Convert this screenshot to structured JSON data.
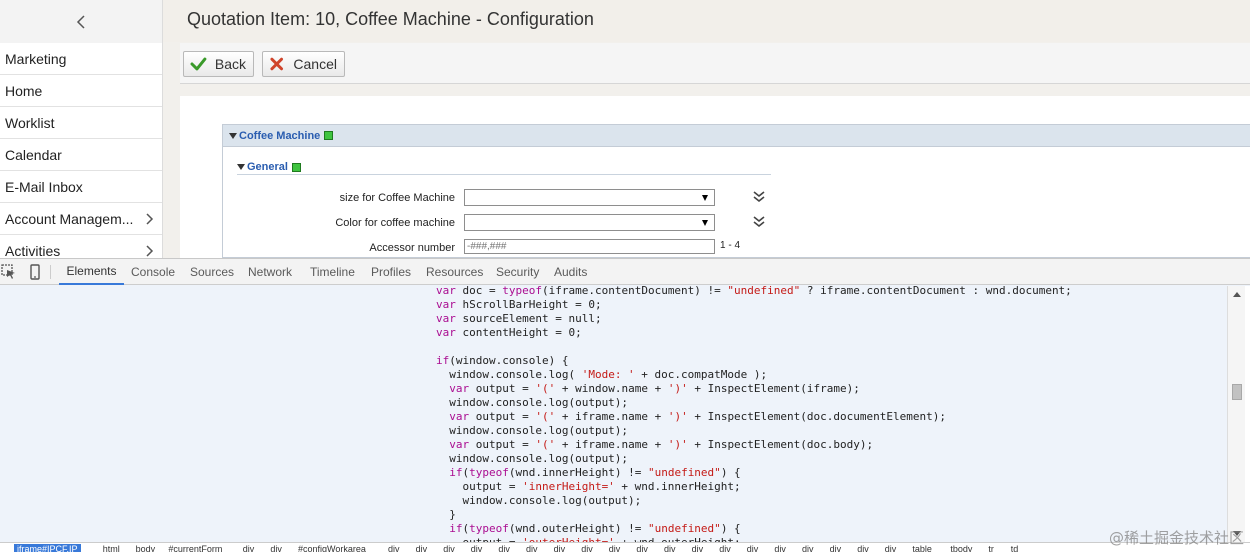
{
  "app": {
    "page_title": "Quotation Item: 10, Coffee Machine - Configuration",
    "sidebar": {
      "collapse_icon": "chevron-left-icon",
      "items": [
        {
          "label": "Marketing",
          "has_submenu": false
        },
        {
          "label": "Home",
          "has_submenu": false
        },
        {
          "label": "Worklist",
          "has_submenu": false
        },
        {
          "label": "Calendar",
          "has_submenu": false
        },
        {
          "label": "E-Mail Inbox",
          "has_submenu": false
        },
        {
          "label": "Account Managem...",
          "has_submenu": true
        },
        {
          "label": "Activities",
          "has_submenu": true
        }
      ]
    },
    "toolbar": {
      "back_label": "Back",
      "cancel_label": "Cancel"
    },
    "config": {
      "panel_title": "Coffee Machine",
      "section_title": "General",
      "fields": {
        "size": {
          "label": "size for Coffee Machine",
          "value": ""
        },
        "color": {
          "label": "Color for coffee machine",
          "value": ""
        },
        "accessor": {
          "label": "Accessor number",
          "placeholder": "-###,###",
          "range": "1 - 4"
        }
      }
    },
    "colors": {
      "status_ok": "#3fc43f",
      "link_blue": "#2a5db0"
    }
  },
  "devtools": {
    "tabs": [
      "Elements",
      "Console",
      "Sources",
      "Network",
      "Timeline",
      "Profiles",
      "Resources",
      "Security",
      "Audits"
    ],
    "active_tab": "Elements",
    "breadcrumb": [
      "iframe#IPCF.IP",
      "html",
      "body",
      "#currentForm",
      "div",
      "div",
      "#configWorkarea",
      "div",
      "div",
      "div",
      "div",
      "div",
      "div",
      "div",
      "div",
      "div",
      "div",
      "div",
      "div",
      "div",
      "div",
      "div",
      "div",
      "div",
      "div",
      "div",
      "table",
      "tbody",
      "tr",
      "td"
    ],
    "code_lines": [
      "var doc = typeof(iframe.contentDocument) != \"undefined\" ? iframe.contentDocument : wnd.document;",
      "var hScrollBarHeight = 0;",
      "var sourceElement = null;",
      "var contentHeight = 0;",
      "",
      "if(window.console) {",
      "  window.console.log( 'Mode: ' + doc.compatMode );",
      "  var output = '(' + window.name + ')' + InspectElement(iframe);",
      "  window.console.log(output);",
      "  var output = '(' + iframe.name + ')' + InspectElement(doc.documentElement);",
      "  window.console.log(output);",
      "  var output = '(' + iframe.name + ')' + InspectElement(doc.body);",
      "  window.console.log(output);",
      "  if(typeof(wnd.innerHeight) != \"undefined\") {",
      "    output = 'innerHeight=' + wnd.innerHeight;",
      "    window.console.log(output);",
      "  }",
      "  if(typeof(wnd.outerHeight) != \"undefined\") {",
      "    output = 'outerHeight=' + wnd.outerHeight;"
    ],
    "watermark": "@稀土掘金技术社区"
  }
}
